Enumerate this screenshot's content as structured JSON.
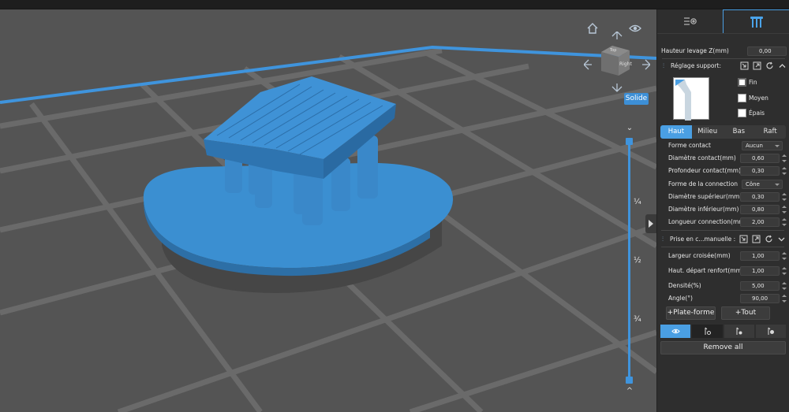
{
  "viewport": {
    "solid_label": "Solide",
    "frac_quarter": "¼",
    "frac_half": "½",
    "frac_three_quarter": "¾",
    "cube_front": "Right",
    "cube_top": "Top"
  },
  "panel": {
    "lift_label": "Hauteur levage Z(mm)",
    "lift_value": "0,00",
    "support_section": "Réglage support:",
    "density_options": [
      {
        "label": "Fin",
        "checked": true
      },
      {
        "label": "Moyen",
        "checked": false
      },
      {
        "label": "Épais",
        "checked": false
      }
    ],
    "subtabs": [
      "Haut",
      "Milieu",
      "Bas",
      "Raft"
    ],
    "fields": {
      "contact_shape_label": "Forme contact",
      "contact_shape_value": "Aucun",
      "contact_diameter_label": "Diamètre contact(mm)",
      "contact_diameter_value": "0,60",
      "contact_depth_label": "Profondeur contact(mm)",
      "contact_depth_value": "0,30",
      "connection_shape_label": "Forme de la connection",
      "connection_shape_value": "Cône",
      "upper_diameter_label": "Diamètre supérieur(mm)",
      "upper_diameter_value": "0,30",
      "lower_diameter_label": "Diamètre inférieur(mm)",
      "lower_diameter_value": "0,80",
      "connection_length_label": "Longueur connection(mm)",
      "connection_length_value": "2,00"
    },
    "manual_section": "Prise en c...manuelle :",
    "manual": {
      "cross_width_label": "Largeur croisée(mm)",
      "cross_width_value": "1,00",
      "reinforce_label": "Haut. départ renfort(mm)",
      "reinforce_value": "1,00",
      "density_label": "Densité(%)",
      "density_value": "5,00",
      "angle_label": "Angle(°)",
      "angle_value": "90,00"
    },
    "add_platform": "+Plate-forme",
    "add_all": "+Tout",
    "remove_all": "Remove all"
  },
  "colors": {
    "accent": "#4a9fe3",
    "model": "#3b8fd1",
    "viewport_bg": "#545454"
  }
}
